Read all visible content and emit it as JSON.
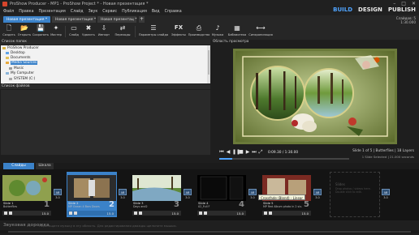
{
  "window": {
    "title": "ProShow Producer - MP1 - ProShow Project * - Новая презентация *",
    "controls": [
      "–",
      "□",
      "✕"
    ]
  },
  "menu": {
    "items": [
      "Файл",
      "Правка",
      "Презентация",
      "Слайд",
      "Звук",
      "Сервис",
      "Публикация",
      "Вид",
      "Справка"
    ],
    "modes": {
      "build": "BUILD",
      "design": "DESIGN",
      "publish": "PUBLISH"
    }
  },
  "tabs": {
    "items": [
      "Новая презентация *",
      "Новая презентация *",
      "Новая презентац *"
    ],
    "add": "+"
  },
  "slide_info": {
    "slides": "Слайдов: 5",
    "duration": "1:30.000"
  },
  "toolbar": {
    "tools": [
      {
        "label": "Создать",
        "icon": "new-icon"
      },
      {
        "label": "Открыть",
        "icon": "open-icon"
      },
      {
        "label": "Сохранить",
        "icon": "save-icon"
      },
      {
        "label": "Мастер",
        "icon": "wizard-icon"
      },
      {
        "label": "Слайд",
        "icon": "slide-icon"
      },
      {
        "label": "Удалить",
        "icon": "delete-icon"
      },
      {
        "label": "Импорт",
        "icon": "import-icon"
      },
      {
        "label": "Переходы",
        "icon": "transitions-icon"
      },
      {
        "label": "Параметры слайда",
        "icon": "slide-options-icon"
      },
      {
        "label": "Эффекты",
        "icon": "effects-icon"
      },
      {
        "label": "Производство",
        "icon": "produce-icon"
      },
      {
        "label": "Музыка",
        "icon": "music-icon"
      },
      {
        "label": "Библиотека",
        "icon": "library-icon"
      },
      {
        "label": "Синхронизация",
        "icon": "sync-icon"
      }
    ]
  },
  "folders": {
    "header": "Список папок",
    "items": [
      {
        "label": "ProShow Producer",
        "color": "#d9b44a"
      },
      {
        "label": "Desktop",
        "color": "#5fa3e8"
      },
      {
        "label": "Documents",
        "color": "#e2c15a"
      },
      {
        "label": "Media Sources",
        "color": "#e8a93c",
        "selected": true
      },
      {
        "label": "Music",
        "color": "#9a9a9a"
      },
      {
        "label": "My Computer",
        "color": "#8ab4d9"
      },
      {
        "label": "SYSTEM (C:)",
        "color": "#a8a8a8"
      }
    ]
  },
  "files": {
    "header": "Список файлов"
  },
  "preview": {
    "header": "Область просмотра"
  },
  "playback": {
    "time": "0:09.30 / 1:30.00",
    "slide_info": "Slide 1 of 5 | Butterflies | 18 Layers",
    "selection_info": "1 Slide Selected | 21.000 seconds",
    "progress": 0.1
  },
  "slide_list": {
    "tabs": [
      "Слайды",
      "Шкала"
    ],
    "slides": [
      {
        "name": "Slide 1",
        "subtitle": "Butterflies",
        "num": "1",
        "time": "15.0"
      },
      {
        "name": "Slide 2",
        "subtitle": "MP Ocean 4 Bars Doors",
        "num": "2",
        "time": "15.0"
      },
      {
        "name": "Slide 3",
        "subtitle": "Days and2",
        "num": "3",
        "time": "15.0"
      },
      {
        "name": "Slide 4",
        "subtitle": "02_Full F",
        "num": "4",
        "time": "15.0"
      },
      {
        "name": "Slide 5",
        "subtitle": "MP Red Album photo in 2 six...",
        "num": "5",
        "time": "15.0"
      }
    ],
    "transitions": [
      {
        "label": "AB",
        "time": "3.0"
      },
      {
        "label": "AB",
        "time": "3.0"
      },
      {
        "label": "AB",
        "time": "3.0"
      },
      {
        "label": "AB",
        "time": "3.0"
      },
      {
        "label": "AB",
        "time": "3.0"
      },
      {
        "label": "AB",
        "time": "3.0"
      }
    ],
    "tooltip": "Crossfade (Blend) - Linear",
    "empty_slot": {
      "title": "Slides",
      "hint": "Drop photos / videos here. Double click to edit."
    }
  },
  "soundtrack": {
    "label": "Звуковая дорожка",
    "hint": "Перетащите музыку в эту область. Для редактирования дважды щелкните мышью."
  }
}
